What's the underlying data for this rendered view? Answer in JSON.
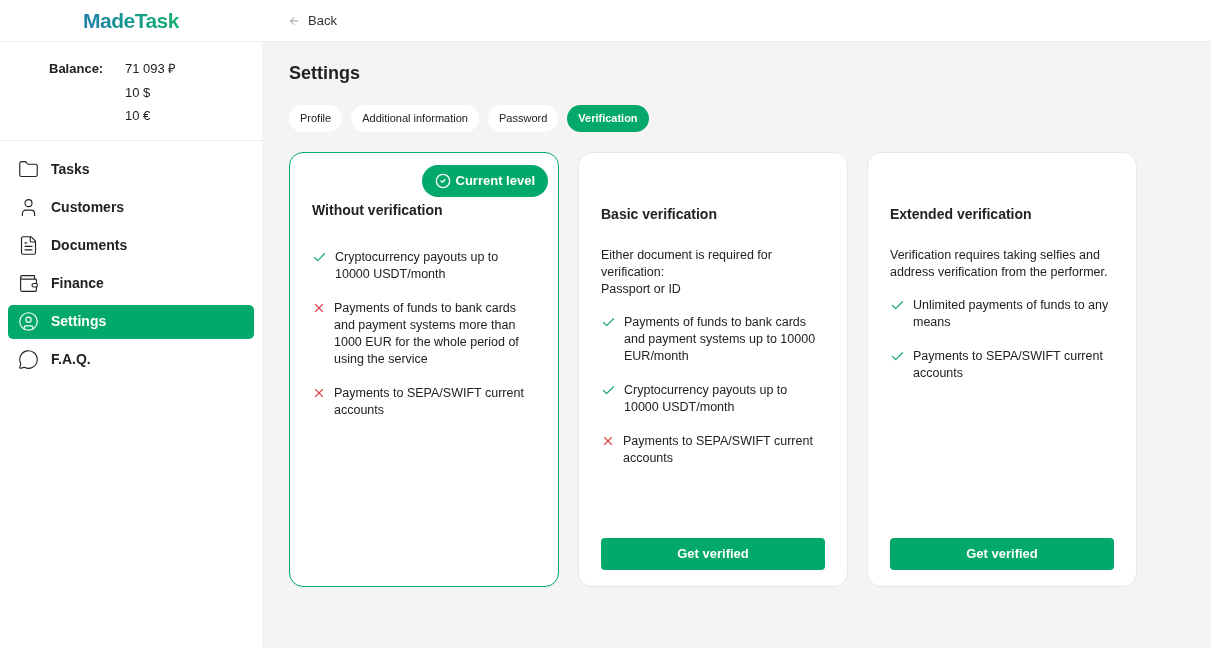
{
  "logo": "MadeTask",
  "back": "Back",
  "balance": {
    "label": "Balance:",
    "amounts": [
      "71 093 ₽",
      "10 $",
      "10 €"
    ]
  },
  "nav": [
    {
      "label": "Tasks",
      "selected": false
    },
    {
      "label": "Customers",
      "selected": false
    },
    {
      "label": "Documents",
      "selected": false
    },
    {
      "label": "Finance",
      "selected": false
    },
    {
      "label": "Settings",
      "selected": true
    },
    {
      "label": "F.A.Q.",
      "selected": false
    }
  ],
  "title": "Settings",
  "tabs": [
    {
      "label": "Profile",
      "selected": false
    },
    {
      "label": "Additional information",
      "selected": false
    },
    {
      "label": "Password",
      "selected": false
    },
    {
      "label": "Verification",
      "selected": true
    }
  ],
  "cards": [
    {
      "title": "Without verification",
      "current": true,
      "badge": "Current level",
      "features": [
        {
          "text": "Cryptocurrency payouts up to 10000 USDT/month",
          "allowed": true
        },
        {
          "text": "Payments of funds to bank cards and payment systems more than 1000 EUR for the whole period of using the service",
          "allowed": false
        },
        {
          "text": "Payments to SEPA/SWIFT current accounts",
          "allowed": false
        }
      ]
    },
    {
      "title": "Basic verification",
      "current": false,
      "description": "Either document is required for verification:\nPassport or ID",
      "features": [
        {
          "text": "Payments of funds to bank cards and payment systems up to 10000 EUR/month",
          "allowed": true
        },
        {
          "text": "Cryptocurrency payouts up to 10000 USDT/month",
          "allowed": true
        },
        {
          "text": "Payments to SEPA/SWIFT current accounts",
          "allowed": false
        }
      ],
      "button": "Get verified"
    },
    {
      "title": "Extended verification",
      "current": false,
      "description": "Verification requires taking selfies and address verification from the performer.",
      "features": [
        {
          "text": "Unlimited payments of funds to any means",
          "allowed": true
        },
        {
          "text": "Payments to SEPA/SWIFT current accounts",
          "allowed": true
        }
      ],
      "button": "Get verified"
    }
  ]
}
